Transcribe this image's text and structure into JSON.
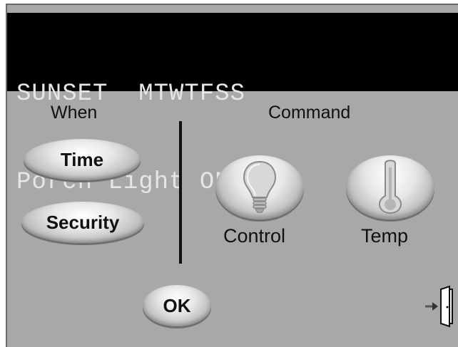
{
  "display": {
    "line1": "SUNSET  MTWTFSS",
    "line2": "Porch Light ON"
  },
  "when": {
    "heading": "When",
    "time_label": "Time",
    "security_label": "Security"
  },
  "command": {
    "heading": "Command",
    "control_label": "Control",
    "temp_label": "Temp",
    "control_icon": "lightbulb-icon",
    "temp_icon": "thermometer-icon"
  },
  "footer": {
    "ok_label": "OK",
    "exit_icon": "exit-door-icon"
  }
}
